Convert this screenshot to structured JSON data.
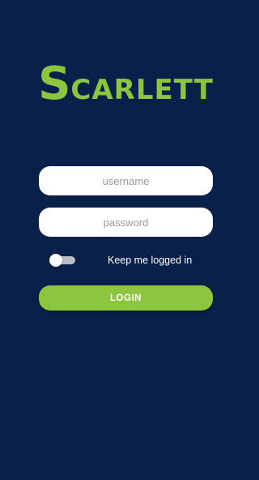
{
  "app": {
    "logo_initial": "S",
    "logo_rest": "CARLETT"
  },
  "form": {
    "username_placeholder": "username",
    "username_value": "",
    "password_placeholder": "password",
    "password_value": "",
    "keep_logged_in_label": "Keep me logged in",
    "keep_logged_in_checked": false,
    "login_label": "LOGIN"
  },
  "colors": {
    "background": "#08204a",
    "accent": "#8cc63f",
    "field_bg": "#ffffff",
    "placeholder": "#9a9a9a",
    "toggle_track": "#b9bdc4"
  }
}
